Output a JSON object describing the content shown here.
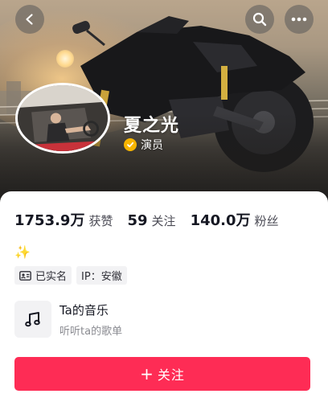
{
  "header": {
    "back_icon": "chevron-left-icon",
    "search_icon": "search-icon",
    "more_icon": "more-horizontal-icon"
  },
  "profile": {
    "username": "夏之光",
    "verification": {
      "icon": "verified-check-icon",
      "label": "演员",
      "badge_color": "#f7b500"
    }
  },
  "stats": [
    {
      "value": "1753.9万",
      "label": "获赞"
    },
    {
      "value": "59",
      "label": "关注"
    },
    {
      "value": "140.0万",
      "label": "粉丝"
    }
  ],
  "bio": {
    "emoji": "✨"
  },
  "tags": [
    {
      "icon": "id-card-icon",
      "label": "已实名"
    },
    {
      "label": "IP：安徽"
    }
  ],
  "music": {
    "icon": "music-note-icon",
    "title": "Ta的音乐",
    "subtitle": "听听ta的歌单"
  },
  "follow_button": {
    "icon": "plus-icon",
    "label": "关注",
    "color": "#fe2c55"
  },
  "colors": {
    "accent": "#fe2c55",
    "text_primary": "#161823",
    "text_secondary": "#8a8b91"
  }
}
